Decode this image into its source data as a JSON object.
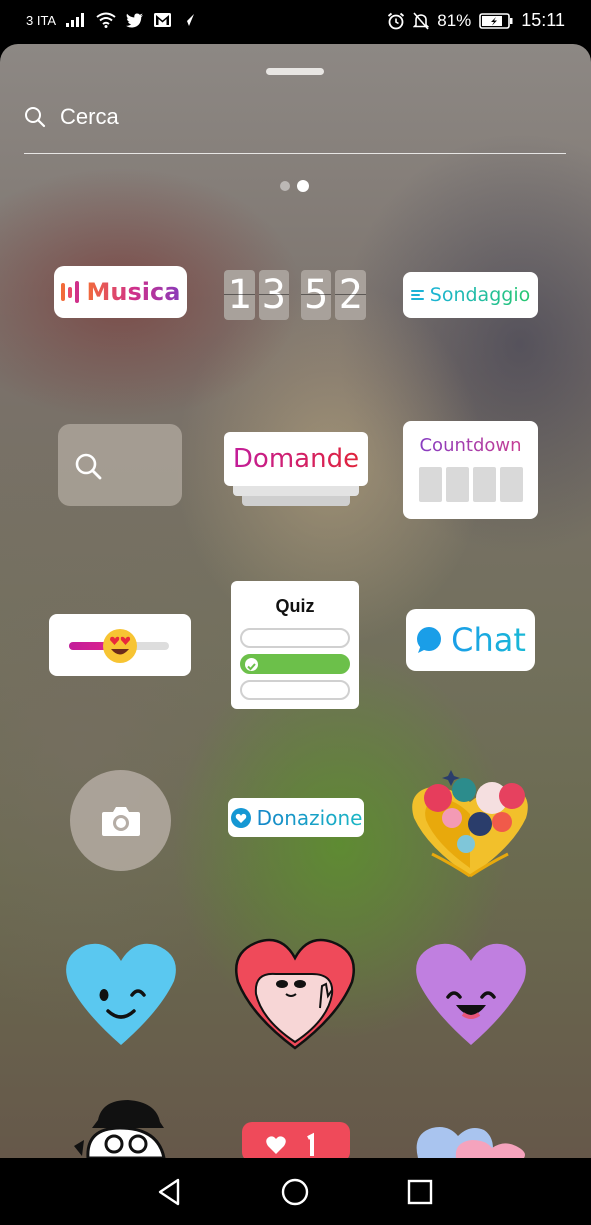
{
  "status_bar": {
    "carrier": "3 ITA",
    "battery_percent": "81%",
    "time": "15:11"
  },
  "search": {
    "placeholder": "Cerca"
  },
  "pager": {
    "pages": 2,
    "active_index": 1
  },
  "stickers": {
    "musica": "Musica",
    "clock_digits": [
      "1",
      "3",
      "5",
      "2"
    ],
    "sondaggio": "Sondaggio",
    "domande": "Domande",
    "countdown": "Countdown",
    "quiz": "Quiz",
    "chat": "Chat",
    "donazione": "Donazione"
  },
  "icons": {
    "back": "back-triangle-icon",
    "home": "home-circle-icon",
    "recents": "recents-square-icon"
  },
  "colors": {
    "musica_gradient": [
      "#f26b3a",
      "#d0308a",
      "#8a3ab9"
    ],
    "sondaggio_gradient": [
      "#1bb3d6",
      "#28c76f"
    ],
    "domande_gradient": [
      "#c21d9a",
      "#e0233a"
    ],
    "chat_blue": "#1a9ee8",
    "quiz_correct": "#6cc04a"
  }
}
